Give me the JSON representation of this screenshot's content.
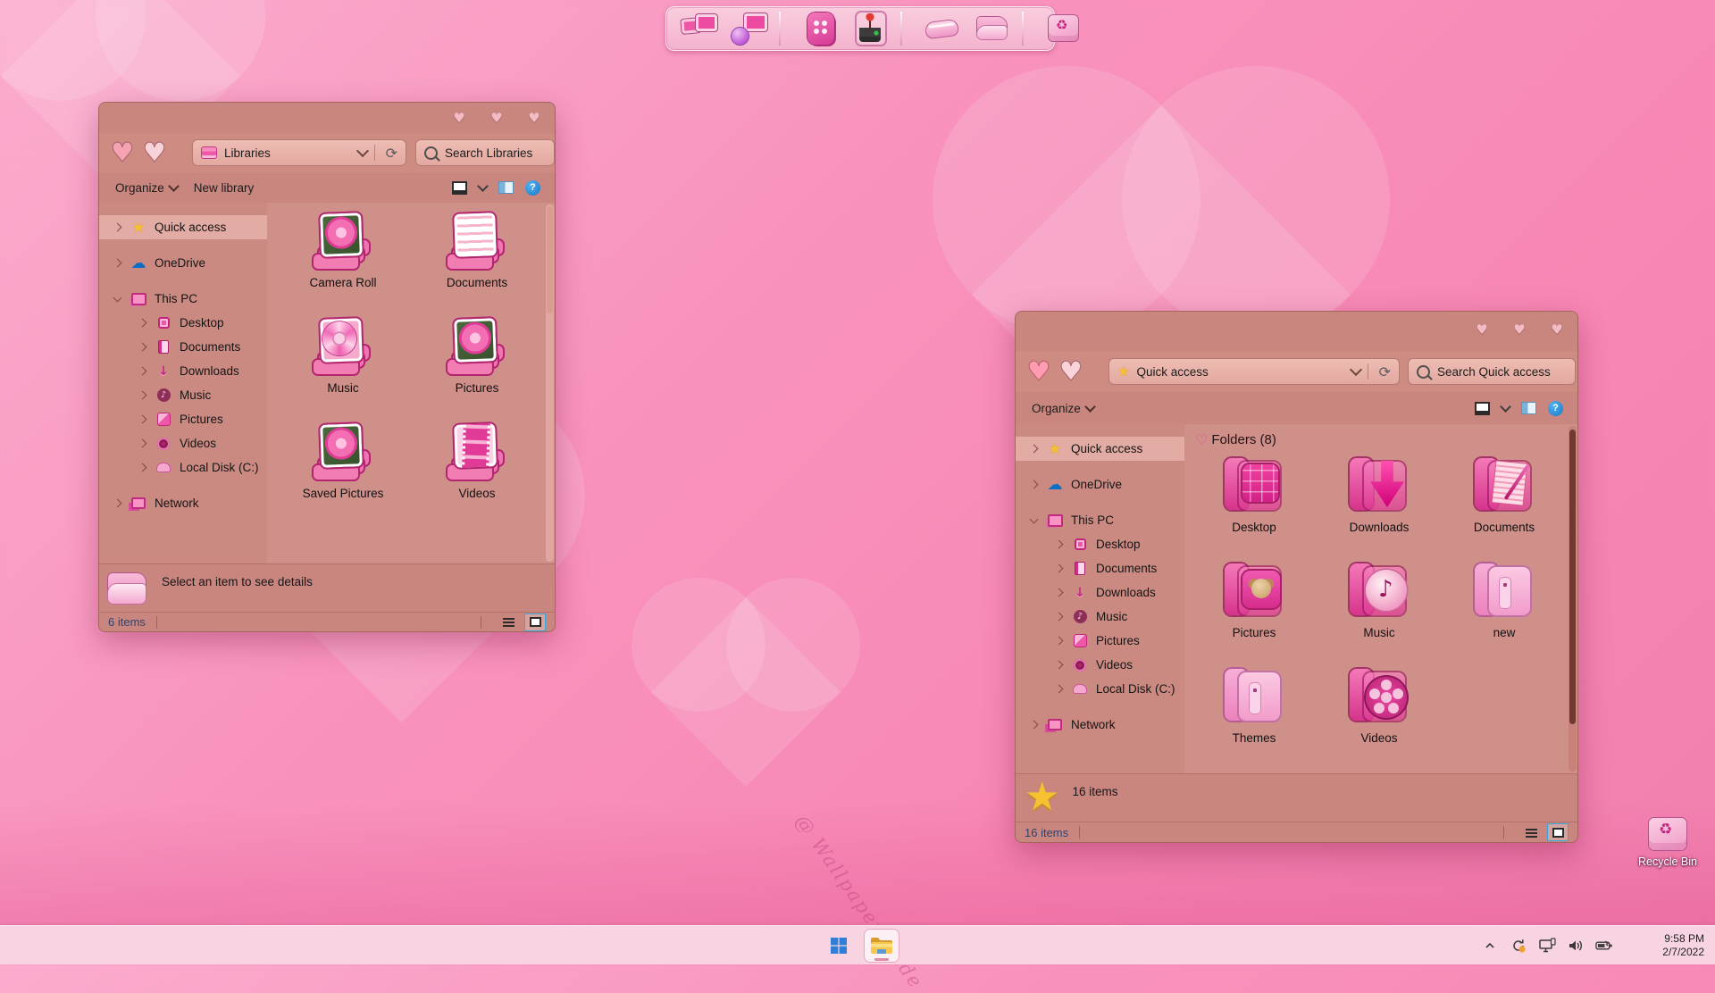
{
  "wallpaper": {
    "credit_text": "@ WallpapersWide"
  },
  "desktop": {
    "recycle_bin_label": "Recycle Bin"
  },
  "dock": {
    "items": [
      {
        "icon": "computer"
      },
      {
        "icon": "network"
      },
      {
        "icon": "control-panel"
      },
      {
        "icon": "games"
      },
      {
        "icon": "wallet"
      },
      {
        "icon": "documents-folder"
      },
      {
        "icon": "recycle-bin"
      }
    ]
  },
  "sidebar_items": [
    {
      "label": "Quick access",
      "icon": "quick-access-star",
      "kind": "star",
      "indent": 0,
      "selected": true
    },
    {
      "label": "OneDrive",
      "icon": "onedrive-cloud",
      "kind": "cloud",
      "indent": 0
    },
    {
      "label": "This PC",
      "icon": "this-pc",
      "kind": "pc",
      "indent": 0,
      "expanded": true
    },
    {
      "label": "Desktop",
      "icon": "desktop",
      "kind": "desktop",
      "indent": 1
    },
    {
      "label": "Documents",
      "icon": "documents",
      "kind": "docs",
      "indent": 1
    },
    {
      "label": "Downloads",
      "icon": "downloads",
      "kind": "down",
      "indent": 1
    },
    {
      "label": "Music",
      "icon": "music",
      "kind": "music",
      "indent": 1
    },
    {
      "label": "Pictures",
      "icon": "pictures",
      "kind": "pics",
      "indent": 1
    },
    {
      "label": "Videos",
      "icon": "videos",
      "kind": "vids",
      "indent": 1
    },
    {
      "label": "Local Disk (C:)",
      "icon": "local-disk",
      "kind": "disk",
      "indent": 1
    },
    {
      "label": "Network",
      "icon": "network",
      "kind": "net",
      "indent": 0
    }
  ],
  "libraries_window": {
    "address": "Libraries",
    "search_text": "Search Libraries",
    "toolbar": {
      "organize_label": "Organize",
      "new_library_label": "New library"
    },
    "items": [
      {
        "label": "Camera Roll",
        "kind": "photo",
        "icon": "camera-roll-library"
      },
      {
        "label": "Documents",
        "kind": "docs",
        "icon": "documents-library"
      },
      {
        "label": "Music",
        "kind": "cd",
        "icon": "music-library"
      },
      {
        "label": "Pictures",
        "kind": "photo",
        "icon": "pictures-library"
      },
      {
        "label": "Saved Pictures",
        "kind": "photo",
        "icon": "saved-pictures-library"
      },
      {
        "label": "Videos",
        "kind": "film",
        "icon": "videos-library"
      }
    ],
    "details_text": "Select an item to see details",
    "status_left": "6 items"
  },
  "quick_access_window": {
    "address": "Quick access",
    "search_text": "Search Quick access",
    "toolbar": {
      "organize_label": "Organize"
    },
    "group_header": "Folders (8)",
    "items": [
      {
        "label": "Desktop",
        "kind": "desktop",
        "icon": "desktop-folder"
      },
      {
        "label": "Downloads",
        "kind": "down",
        "icon": "downloads-folder"
      },
      {
        "label": "Documents",
        "kind": "docs",
        "icon": "documents-folder"
      },
      {
        "label": "Pictures",
        "kind": "pics",
        "icon": "pictures-folder"
      },
      {
        "label": "Music",
        "kind": "music",
        "icon": "music-folder"
      },
      {
        "label": "new",
        "kind": "plain",
        "icon": "new-folder"
      },
      {
        "label": "Themes",
        "kind": "plain",
        "icon": "themes-folder"
      },
      {
        "label": "Videos",
        "kind": "reel",
        "icon": "videos-folder"
      }
    ],
    "details_text": "16 items",
    "status_left": "16 items"
  },
  "taskbar": {
    "time": "9:58 PM",
    "date": "2/7/2022"
  },
  "colors": {
    "window_chrome": "#c9867e",
    "accent_pink": "#e23a97",
    "taskbar_pink": "#f8d4e2",
    "desktop_pink": "#f787b4",
    "selection_blue": "#35a7dd",
    "help_blue": "#1479c9",
    "star_gold": "#f6c231"
  }
}
